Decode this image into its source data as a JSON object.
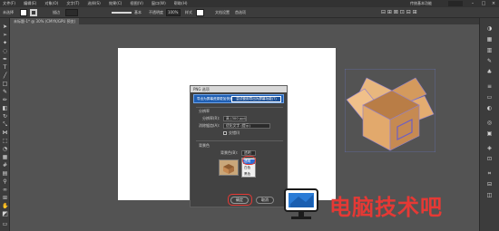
{
  "menubar": {
    "items": [
      "文件(F)",
      "编辑(E)",
      "对象(O)",
      "文字(T)",
      "选择(S)",
      "效果(C)",
      "视图(V)",
      "窗口(W)",
      "帮助(H)"
    ],
    "workspace": "传统基本功能"
  },
  "controlbar": {
    "label": "未选择",
    "stroke_label": "描边",
    "stroke_preset": "基本",
    "opacity_label": "不透明度",
    "opacity_value": "100%",
    "style_label": "样式",
    "doc_setup": "文档设置",
    "prefs": "首选项"
  },
  "document_tab": {
    "title": "未标题-1* @ 30% (CMYK/GPU 预览)"
  },
  "dialog": {
    "title": "PNG 选项",
    "notice": "导出为屏幕资源更加快速。",
    "notice_button": "尝试使用导出为屏幕功能(T)",
    "resolution_section": "分辨率",
    "resolution_label": "分辨率(R):",
    "resolution_value": "高 (300 ppi)",
    "antialias_label": "消除锯齿(A):",
    "antialias_value": "优化文字 (提示)",
    "interlace_label": "交错(I)",
    "background_section": "背景色",
    "background_label": "背景色(B):",
    "background_value": "透明",
    "bg_options": [
      "透明",
      "白色",
      "黑色"
    ],
    "ok_label": "确定",
    "cancel_label": "取消"
  },
  "watermark": {
    "text": "电脑技术吧"
  },
  "colors": {
    "workspace_bg": "#535353",
    "panel_bg": "#3c3c3c",
    "artboard": "#ffffff",
    "highlight_ring": "#e53935",
    "dialog_accent": "#1f5fb4",
    "box_tan": "#d9a56c"
  }
}
